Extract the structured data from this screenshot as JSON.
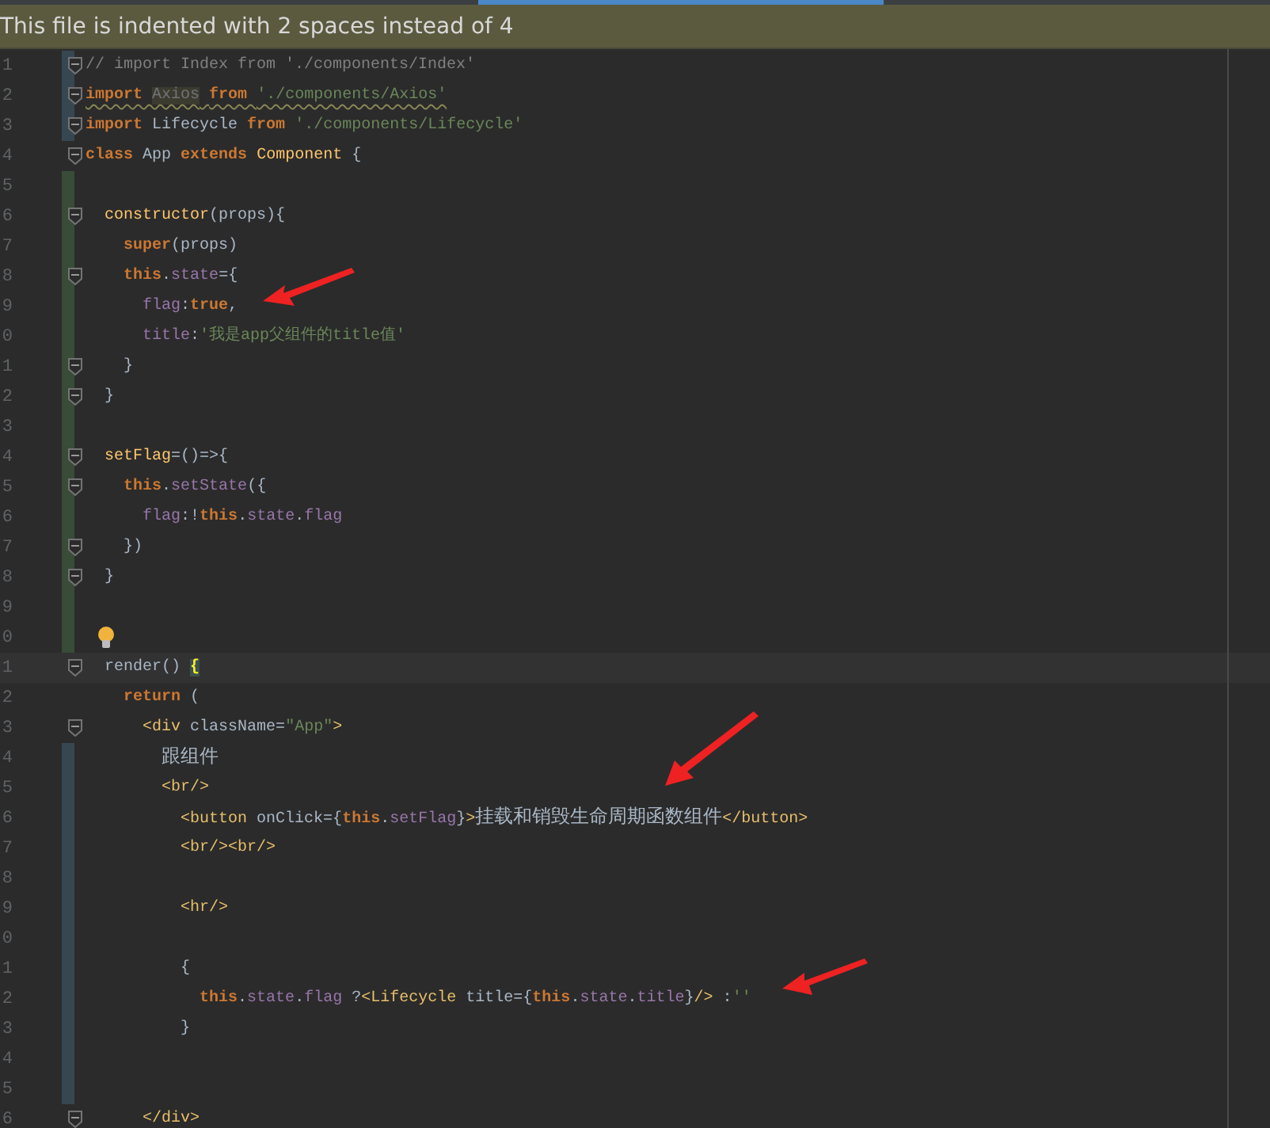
{
  "banner": {
    "text": "This file is indented with 2 spaces instead of 4"
  },
  "lines": [
    {
      "number": "1",
      "modified": true,
      "added": false,
      "fold": true,
      "tokens": [
        {
          "kind": "comment",
          "text": "// import Index from './components/Index'"
        }
      ]
    },
    {
      "number": "2",
      "modified": true,
      "added": false,
      "fold": true,
      "squiggle": true,
      "tokens": [
        {
          "kind": "keyword",
          "text": "import "
        },
        {
          "kind": "unused",
          "text": "Axios"
        },
        {
          "kind": "keyword",
          "text": " from "
        },
        {
          "kind": "string",
          "text": "'./components/Axios'"
        }
      ]
    },
    {
      "number": "3",
      "modified": true,
      "added": false,
      "fold": true,
      "tokens": [
        {
          "kind": "keyword",
          "text": "import"
        },
        {
          "kind": "plain",
          "text": " Lifecycle "
        },
        {
          "kind": "keyword",
          "text": "from"
        },
        {
          "kind": "string",
          "text": " './components/Lifecycle'"
        }
      ]
    },
    {
      "number": "4",
      "modified": false,
      "added": false,
      "fold": true,
      "tokens": [
        {
          "kind": "keyword",
          "text": "class"
        },
        {
          "kind": "plain",
          "text": " App "
        },
        {
          "kind": "keyword",
          "text": "extends"
        },
        {
          "kind": "function",
          "text": " Component"
        },
        {
          "kind": "plain",
          "text": " {"
        }
      ]
    },
    {
      "number": "5",
      "modified": false,
      "added": true,
      "fold": false
    },
    {
      "number": "6",
      "modified": false,
      "added": true,
      "fold": true,
      "tokens": [
        {
          "kind": "function",
          "text": "  constructor"
        },
        {
          "kind": "plain",
          "text": "(props){"
        }
      ]
    },
    {
      "number": "7",
      "modified": false,
      "added": true,
      "fold": false,
      "tokens": [
        {
          "kind": "keyword",
          "text": "    super"
        },
        {
          "kind": "plain",
          "text": "(props)"
        }
      ]
    },
    {
      "number": "8",
      "modified": false,
      "added": true,
      "fold": true,
      "tokens": [
        {
          "kind": "keyword",
          "text": "    this"
        },
        {
          "kind": "plain",
          "text": "."
        },
        {
          "kind": "property",
          "text": "state"
        },
        {
          "kind": "plain",
          "text": "={"
        }
      ]
    },
    {
      "number": "9",
      "modified": false,
      "added": true,
      "fold": false,
      "tokens": [
        {
          "kind": "property",
          "text": "      flag"
        },
        {
          "kind": "plain",
          "text": ":"
        },
        {
          "kind": "keyword",
          "text": "true"
        },
        {
          "kind": "plain",
          "text": ","
        }
      ]
    },
    {
      "number": "0",
      "modified": false,
      "added": true,
      "fold": false,
      "tokens": [
        {
          "kind": "property",
          "text": "      title"
        },
        {
          "kind": "plain",
          "text": ":"
        },
        {
          "kind": "string",
          "text": "'我是app父组件的title值'"
        }
      ]
    },
    {
      "number": "1",
      "modified": false,
      "added": true,
      "fold": true,
      "tokens": [
        {
          "kind": "plain",
          "text": "    }"
        }
      ]
    },
    {
      "number": "2",
      "modified": false,
      "added": true,
      "fold": true,
      "tokens": [
        {
          "kind": "plain",
          "text": "  }"
        }
      ]
    },
    {
      "number": "3",
      "modified": false,
      "added": true,
      "fold": false
    },
    {
      "number": "4",
      "modified": false,
      "added": true,
      "fold": true,
      "tokens": [
        {
          "kind": "function",
          "text": "  setFlag"
        },
        {
          "kind": "plain",
          "text": "=()=>{"
        }
      ]
    },
    {
      "number": "5",
      "modified": false,
      "added": true,
      "fold": true,
      "tokens": [
        {
          "kind": "keyword",
          "text": "    this"
        },
        {
          "kind": "plain",
          "text": "."
        },
        {
          "kind": "property",
          "text": "setState"
        },
        {
          "kind": "plain",
          "text": "({"
        }
      ]
    },
    {
      "number": "6",
      "modified": false,
      "added": true,
      "fold": false,
      "tokens": [
        {
          "kind": "property",
          "text": "      flag"
        },
        {
          "kind": "plain",
          "text": ":!"
        },
        {
          "kind": "keyword",
          "text": "this"
        },
        {
          "kind": "plain",
          "text": "."
        },
        {
          "kind": "property",
          "text": "state"
        },
        {
          "kind": "plain",
          "text": "."
        },
        {
          "kind": "property",
          "text": "flag"
        }
      ]
    },
    {
      "number": "7",
      "modified": false,
      "added": true,
      "fold": true,
      "tokens": [
        {
          "kind": "plain",
          "text": "    })"
        }
      ]
    },
    {
      "number": "8",
      "modified": false,
      "added": true,
      "fold": true,
      "tokens": [
        {
          "kind": "plain",
          "text": "  }"
        }
      ]
    },
    {
      "number": "9",
      "modified": false,
      "added": true,
      "fold": false
    },
    {
      "number": "0",
      "modified": false,
      "added": true,
      "fold": false,
      "bulb": true
    },
    {
      "number": "1",
      "modified": false,
      "added": false,
      "fold": true,
      "current": true,
      "tokens": [
        {
          "kind": "plain",
          "text": "  render() "
        },
        {
          "kind": "brace",
          "text": "{"
        }
      ]
    },
    {
      "number": "2",
      "modified": false,
      "added": false,
      "fold": false,
      "tokens": [
        {
          "kind": "keyword",
          "text": "    return"
        },
        {
          "kind": "plain",
          "text": " ("
        }
      ]
    },
    {
      "number": "3",
      "modified": false,
      "added": false,
      "fold": true,
      "tokens": [
        {
          "kind": "tag",
          "text": "      <div"
        },
        {
          "kind": "plain",
          "text": " className="
        },
        {
          "kind": "string",
          "text": "\"App\""
        },
        {
          "kind": "tag",
          "text": ">"
        }
      ]
    },
    {
      "number": "4",
      "modified": true,
      "added": false,
      "fold": false,
      "tokens": [
        {
          "kind": "cjk",
          "text": "        跟组件"
        }
      ]
    },
    {
      "number": "5",
      "modified": true,
      "added": false,
      "fold": false,
      "tokens": [
        {
          "kind": "tag",
          "text": "        <br/>"
        }
      ]
    },
    {
      "number": "6",
      "modified": true,
      "added": false,
      "fold": false,
      "tokens": [
        {
          "kind": "tag",
          "text": "          <button"
        },
        {
          "kind": "plain",
          "text": " onClick={"
        },
        {
          "kind": "keyword",
          "text": "this"
        },
        {
          "kind": "plain",
          "text": "."
        },
        {
          "kind": "property",
          "text": "setFlag"
        },
        {
          "kind": "plain",
          "text": "}"
        },
        {
          "kind": "tag",
          "text": ">"
        },
        {
          "kind": "cjk",
          "text": "挂载和销毁生命周期函数组件"
        },
        {
          "kind": "tag",
          "text": "</button>"
        }
      ]
    },
    {
      "number": "7",
      "modified": true,
      "added": false,
      "fold": false,
      "tokens": [
        {
          "kind": "tag",
          "text": "          <br/><br/>"
        }
      ]
    },
    {
      "number": "8",
      "modified": true,
      "added": false,
      "fold": false
    },
    {
      "number": "9",
      "modified": true,
      "added": false,
      "fold": false,
      "tokens": [
        {
          "kind": "tag",
          "text": "          <hr/>"
        }
      ]
    },
    {
      "number": "0",
      "modified": true,
      "added": false,
      "fold": false
    },
    {
      "number": "1",
      "modified": true,
      "added": false,
      "fold": false,
      "tokens": [
        {
          "kind": "plain",
          "text": "          {"
        }
      ]
    },
    {
      "number": "2",
      "modified": true,
      "added": false,
      "fold": false,
      "tokens": [
        {
          "kind": "keyword",
          "text": "            this"
        },
        {
          "kind": "plain",
          "text": "."
        },
        {
          "kind": "property",
          "text": "state"
        },
        {
          "kind": "plain",
          "text": "."
        },
        {
          "kind": "property",
          "text": "flag"
        },
        {
          "kind": "plain",
          "text": " ?"
        },
        {
          "kind": "tag",
          "text": "<Lifecycle"
        },
        {
          "kind": "plain",
          "text": " title={"
        },
        {
          "kind": "keyword",
          "text": "this"
        },
        {
          "kind": "plain",
          "text": "."
        },
        {
          "kind": "property",
          "text": "state"
        },
        {
          "kind": "plain",
          "text": "."
        },
        {
          "kind": "property",
          "text": "title"
        },
        {
          "kind": "plain",
          "text": "}"
        },
        {
          "kind": "tag",
          "text": "/>"
        },
        {
          "kind": "plain",
          "text": " :"
        },
        {
          "kind": "string",
          "text": "''"
        }
      ]
    },
    {
      "number": "3",
      "modified": true,
      "added": false,
      "fold": false,
      "tokens": [
        {
          "kind": "plain",
          "text": "          }"
        }
      ]
    },
    {
      "number": "4",
      "modified": true,
      "added": false,
      "fold": false
    },
    {
      "number": "5",
      "modified": true,
      "added": false,
      "fold": false
    },
    {
      "number": "6",
      "modified": false,
      "added": false,
      "fold": true,
      "tokens": [
        {
          "kind": "tag",
          "text": "      </div>"
        }
      ]
    }
  ],
  "annotations": [
    {
      "kind": "arrow"
    },
    {
      "kind": "arrow"
    },
    {
      "kind": "arrow"
    }
  ]
}
